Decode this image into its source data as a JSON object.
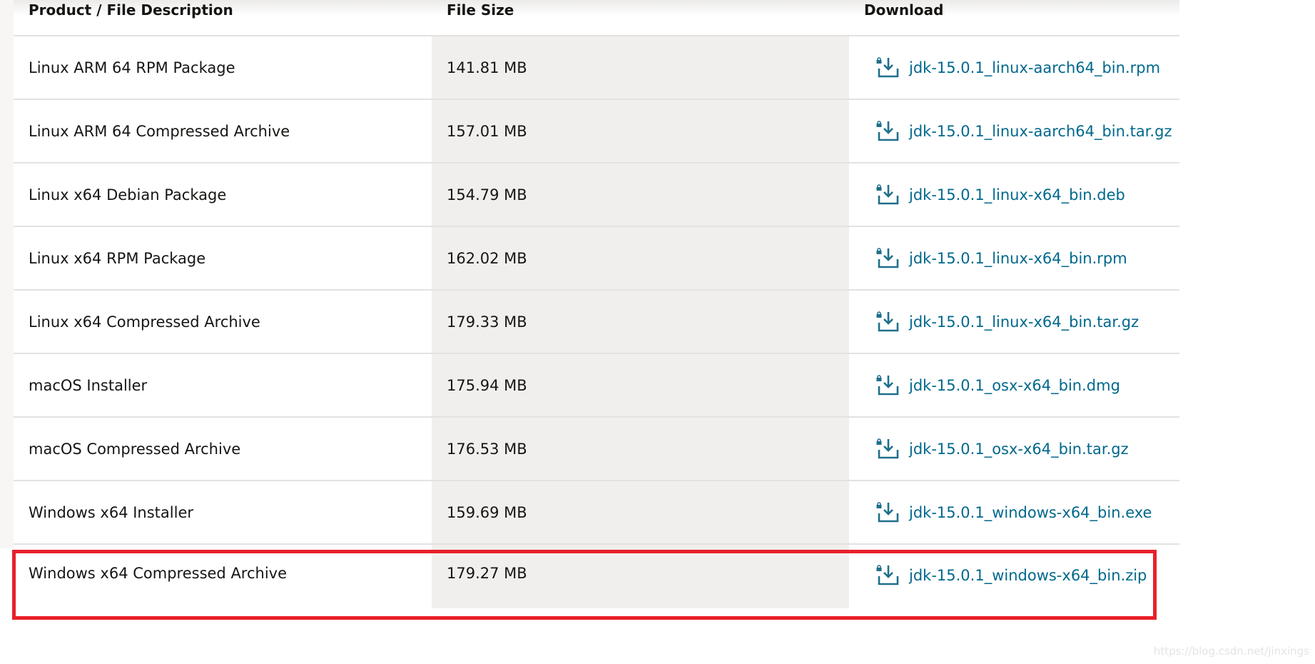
{
  "table": {
    "headers": [
      "Product / File Description",
      "File Size",
      "Download"
    ],
    "rows": [
      {
        "description": "Linux ARM 64 RPM Package",
        "size": "141.81 MB",
        "file": "jdk-15.0.1_linux-aarch64_bin.rpm"
      },
      {
        "description": "Linux ARM 64 Compressed Archive",
        "size": "157.01 MB",
        "file": "jdk-15.0.1_linux-aarch64_bin.tar.gz"
      },
      {
        "description": "Linux x64 Debian Package",
        "size": "154.79 MB",
        "file": "jdk-15.0.1_linux-x64_bin.deb"
      },
      {
        "description": "Linux x64 RPM Package",
        "size": "162.02 MB",
        "file": "jdk-15.0.1_linux-x64_bin.rpm"
      },
      {
        "description": "Linux x64 Compressed Archive",
        "size": "179.33 MB",
        "file": "jdk-15.0.1_linux-x64_bin.tar.gz"
      },
      {
        "description": "macOS Installer",
        "size": "175.94 MB",
        "file": "jdk-15.0.1_osx-x64_bin.dmg"
      },
      {
        "description": "macOS Compressed Archive",
        "size": "176.53 MB",
        "file": "jdk-15.0.1_osx-x64_bin.tar.gz"
      },
      {
        "description": "Windows x64 Installer",
        "size": "159.69 MB",
        "file": "jdk-15.0.1_windows-x64_bin.exe"
      },
      {
        "description": "Windows x64 Compressed Archive",
        "size": "179.27 MB",
        "file": "jdk-15.0.1_windows-x64_bin.zip"
      }
    ]
  },
  "icon": "lock-download-icon",
  "colors": {
    "link": "#00688c",
    "highlight": "#e8202a",
    "size_column": "#f1efed"
  },
  "watermark": "https://blog.csdn.net/jinxings"
}
